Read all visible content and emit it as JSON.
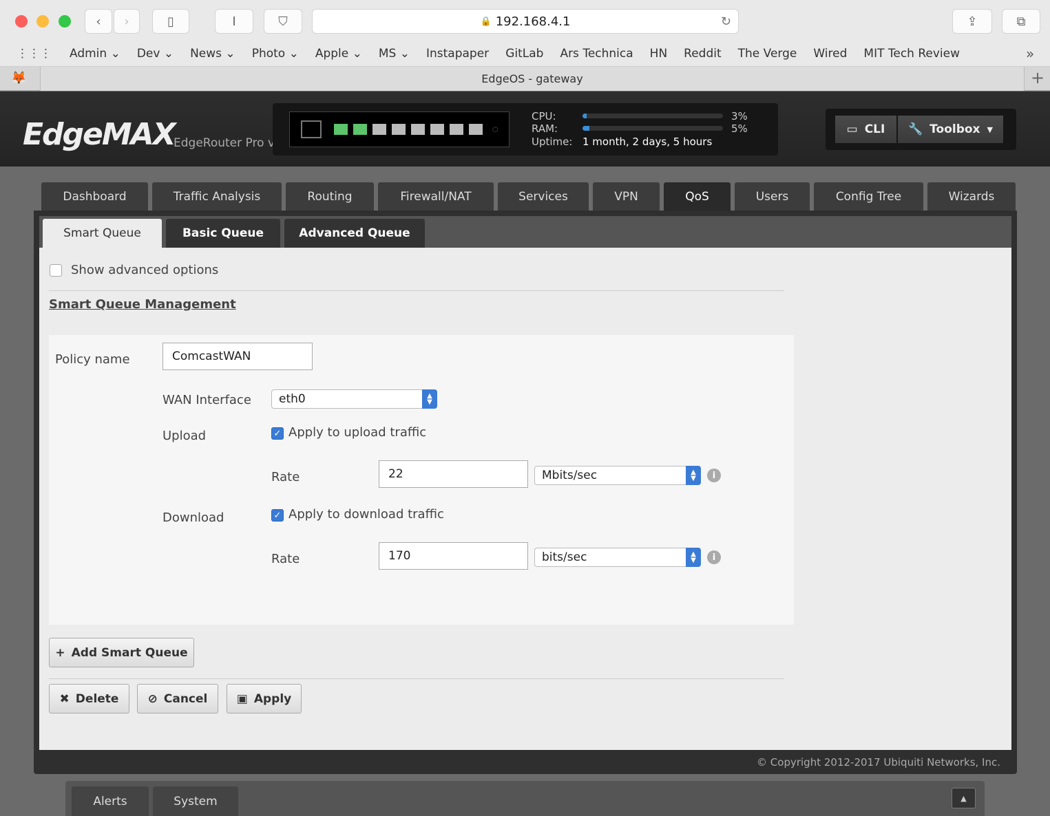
{
  "browser": {
    "url": "192.168.4.1",
    "tab_title": "EdgeOS - gateway",
    "bookmarks": [
      "Admin ⌄",
      "Dev ⌄",
      "News ⌄",
      "Photo ⌄",
      "Apple ⌄",
      "MS ⌄",
      "Instapaper",
      "GitLab",
      "Ars Technica",
      "HN",
      "Reddit",
      "The Verge",
      "Wired",
      "MIT Tech Review"
    ],
    "more": "»"
  },
  "header": {
    "logo": "EdgeMAX",
    "model": "EdgeRouter Pro v",
    "cpu_label": "CPU:",
    "cpu_value": "3%",
    "cpu_pct": 3,
    "ram_label": "RAM:",
    "ram_value": "5%",
    "ram_pct": 5,
    "uptime_label": "Uptime:",
    "uptime_value": "1 month, 2 days, 5 hours",
    "ports_up": [
      true,
      true,
      false,
      false,
      false,
      false,
      false,
      false
    ],
    "cli": "CLI",
    "toolbox": "Toolbox"
  },
  "nav": {
    "tabs": [
      "Dashboard",
      "Traffic Analysis",
      "Routing",
      "Firewall/NAT",
      "Services",
      "VPN",
      "QoS",
      "Users",
      "Config Tree",
      "Wizards"
    ],
    "active": "QoS"
  },
  "subtabs": {
    "tabs": [
      "Smart Queue",
      "Basic Queue",
      "Advanced Queue"
    ],
    "active": "Smart Queue"
  },
  "form": {
    "show_advanced": "Show advanced options",
    "section_title": "Smart Queue Management",
    "policy_label": "Policy name",
    "policy_value": "ComcastWAN",
    "wan_label": "WAN Interface",
    "wan_value": "eth0",
    "upload_label": "Upload",
    "upload_check": "Apply to upload traffic",
    "upload_rate_label": "Rate",
    "upload_rate": "22",
    "upload_unit": "Mbits/sec",
    "download_label": "Download",
    "download_check": "Apply to download traffic",
    "download_rate_label": "Rate",
    "download_rate": "170",
    "download_unit": "bits/sec"
  },
  "buttons": {
    "add": "Add Smart Queue",
    "delete": "Delete",
    "cancel": "Cancel",
    "apply": "Apply"
  },
  "footer": {
    "copyright": "© Copyright 2012-2017 Ubiquiti Networks, Inc."
  },
  "bottom": {
    "tabs": [
      "Alerts",
      "System"
    ]
  },
  "colors": {
    "accent": "#3a7bd5",
    "port_up": "#5cc46a"
  }
}
